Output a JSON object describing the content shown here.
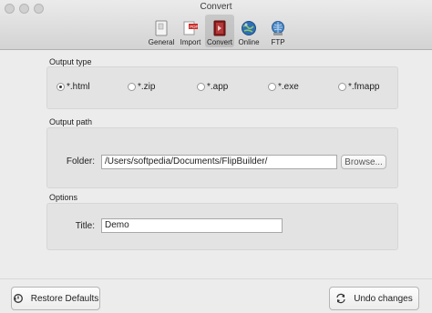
{
  "window": {
    "title": "Convert"
  },
  "toolbar": {
    "items": [
      {
        "label": "General",
        "icon": "general-icon",
        "active": false
      },
      {
        "label": "Import",
        "icon": "import-icon",
        "active": false
      },
      {
        "label": "Convert",
        "icon": "convert-icon",
        "active": true
      },
      {
        "label": "Online",
        "icon": "online-icon",
        "active": false
      },
      {
        "label": "FTP",
        "icon": "ftp-icon",
        "active": false
      }
    ]
  },
  "output_type": {
    "section_label": "Output type",
    "options": [
      {
        "label": "*.html",
        "checked": true
      },
      {
        "label": "*.zip",
        "checked": false
      },
      {
        "label": "*.app",
        "checked": false
      },
      {
        "label": "*.exe",
        "checked": false
      },
      {
        "label": "*.fmapp",
        "checked": false
      }
    ]
  },
  "output_path": {
    "section_label": "Output path",
    "folder_label": "Folder:",
    "folder_value": "/Users/softpedia/Documents/FlipBuilder/",
    "browse_label": "Browse..."
  },
  "options": {
    "section_label": "Options",
    "title_label": "Title:",
    "title_value": "Demo"
  },
  "footer": {
    "restore_label": "Restore Defaults",
    "undo_label": "Undo changes"
  }
}
